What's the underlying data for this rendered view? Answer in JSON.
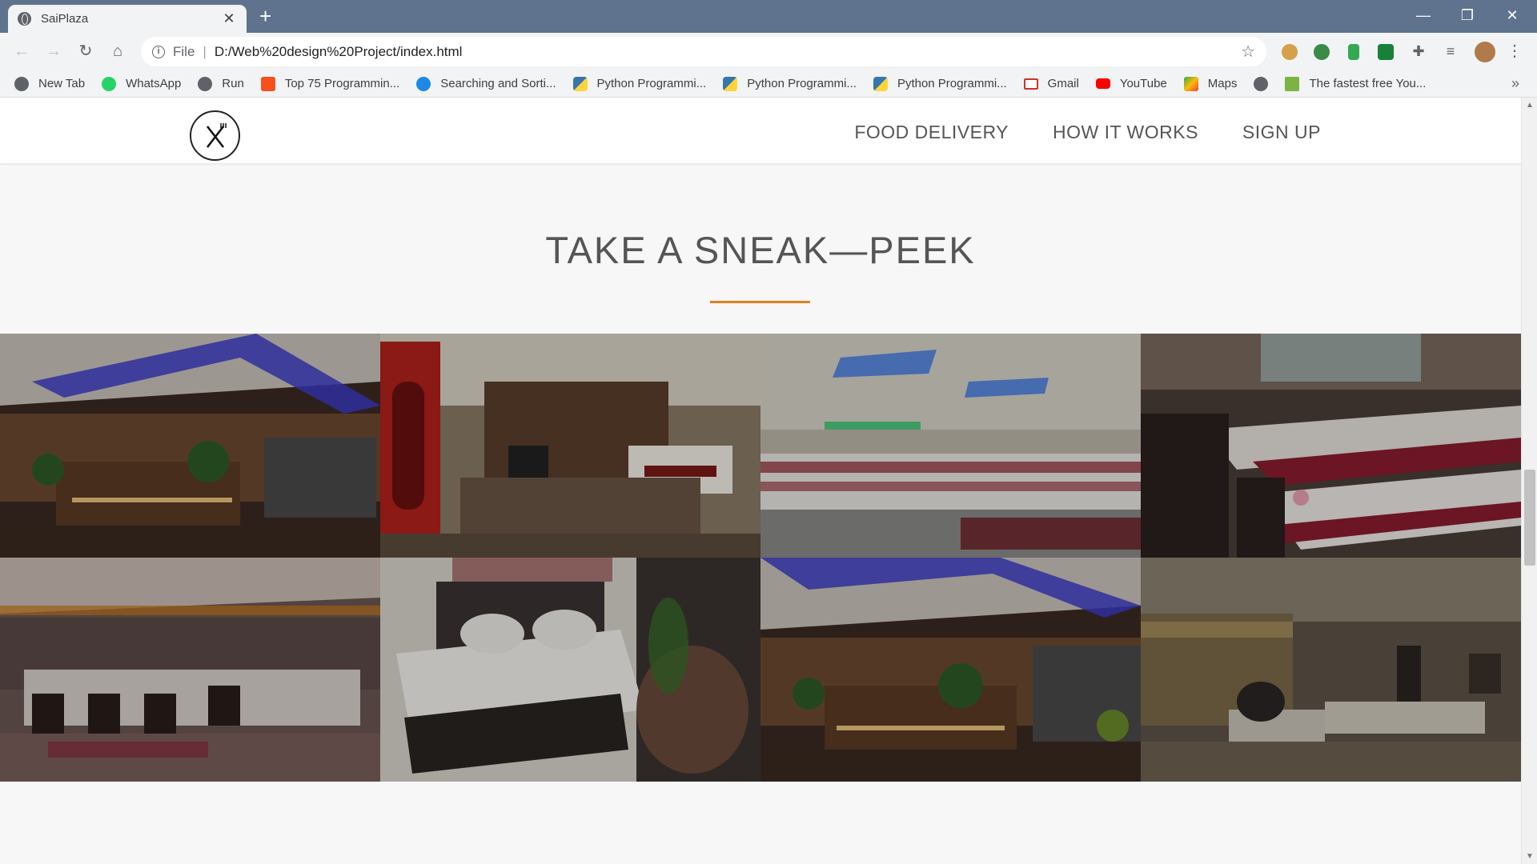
{
  "browser": {
    "tab_title": "SaiPlaza",
    "tab_close": "✕",
    "new_tab": "+",
    "url_scheme": "File",
    "url": "D:/Web%20design%20Project/index.html",
    "window_controls": [
      "—",
      "❐",
      "✕"
    ]
  },
  "bookmarks": [
    {
      "label": "New Tab",
      "color": "#5f6368"
    },
    {
      "label": "WhatsApp",
      "color": "#25d366"
    },
    {
      "label": "Run",
      "color": "#5f6368"
    },
    {
      "label": "Top 75 Programmin...",
      "color": "#f4511e"
    },
    {
      "label": "Searching and Sorti...",
      "color": "#1e88e5"
    },
    {
      "label": "Python Programmi...",
      "color": "#3776ab"
    },
    {
      "label": "Python Programmi...",
      "color": "#3776ab"
    },
    {
      "label": "Python Programmi...",
      "color": "#3776ab"
    },
    {
      "label": "Gmail",
      "color": "#d93025"
    },
    {
      "label": "YouTube",
      "color": "#ff0000"
    },
    {
      "label": "Maps",
      "color": "#34a853"
    },
    {
      "label": "",
      "color": "#5f6368"
    },
    {
      "label": "The fastest free You...",
      "color": "#7cb342"
    }
  ],
  "site": {
    "nav": [
      "FOOD DELIVERY",
      "HOW IT WORKS",
      "SIGN UP"
    ],
    "section_title": "TAKE A SNEAK—PEEK",
    "accent_color": "#e67e22"
  }
}
